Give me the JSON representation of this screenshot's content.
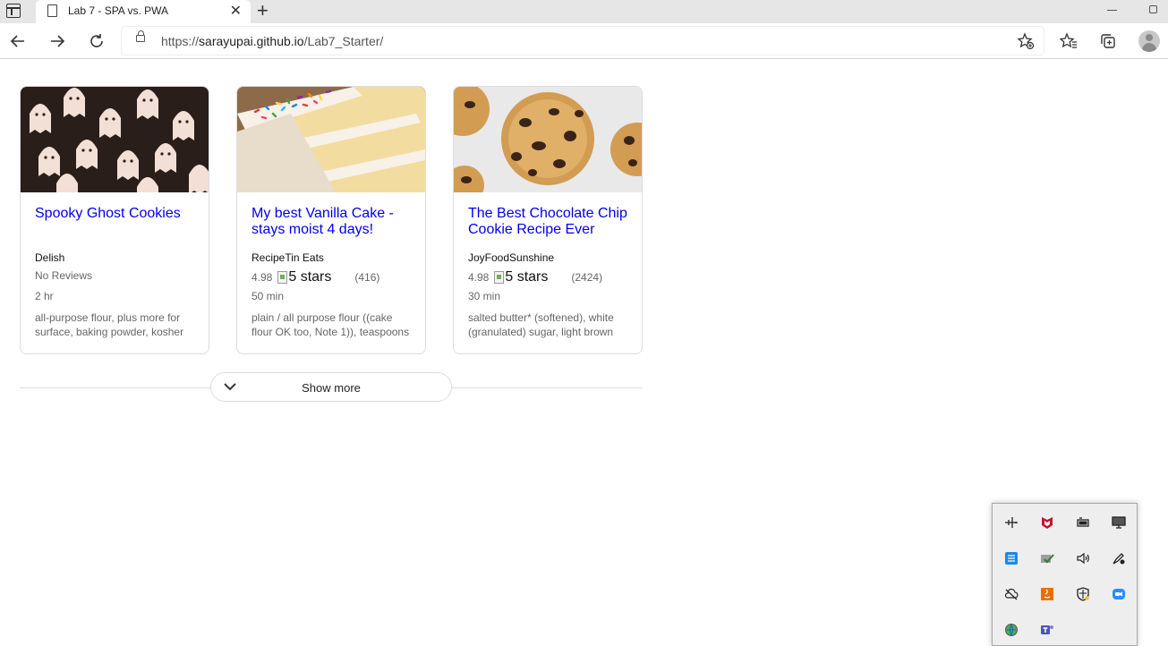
{
  "browser": {
    "tab_title": "Lab 7 - SPA vs. PWA",
    "url_prefix": "https://",
    "url_host": "sarayupai.github.io",
    "url_path": "/Lab7_Starter/"
  },
  "recipes": [
    {
      "title": "Spooky Ghost Cookies",
      "org": "Delish",
      "rating": "No Reviews",
      "time": "2 hr",
      "ingredients": "all-purpose flour, plus more for surface, baking powder, kosher"
    },
    {
      "title": "My best Vanilla Cake - stays moist 4 days!",
      "org": "RecipeTin Eats",
      "rating": "4.98",
      "rating_alt": "5 stars",
      "rating_count": "(416)",
      "time": "50 min",
      "ingredients": "plain / all purpose flour ((cake flour OK too, Note 1)), teaspoons"
    },
    {
      "title": "The Best Chocolate Chip Cookie Recipe Ever",
      "org": "JoyFoodSunshine",
      "rating": "4.98",
      "rating_alt": "5 stars",
      "rating_count": "(2424)",
      "time": "30 min",
      "ingredients": "salted butter* (softened), white (granulated) sugar, light brown"
    }
  ],
  "show_more_label": "Show more",
  "tray_icons": [
    "airplane-icon",
    "mcafee-icon",
    "battery-icon",
    "monitor-icon",
    "network-icon",
    "check-icon",
    "volume-icon",
    "pen-icon",
    "cloud-off-icon",
    "java-icon",
    "defender-icon",
    "zoom-icon",
    "globe-icon",
    "teams-icon"
  ]
}
